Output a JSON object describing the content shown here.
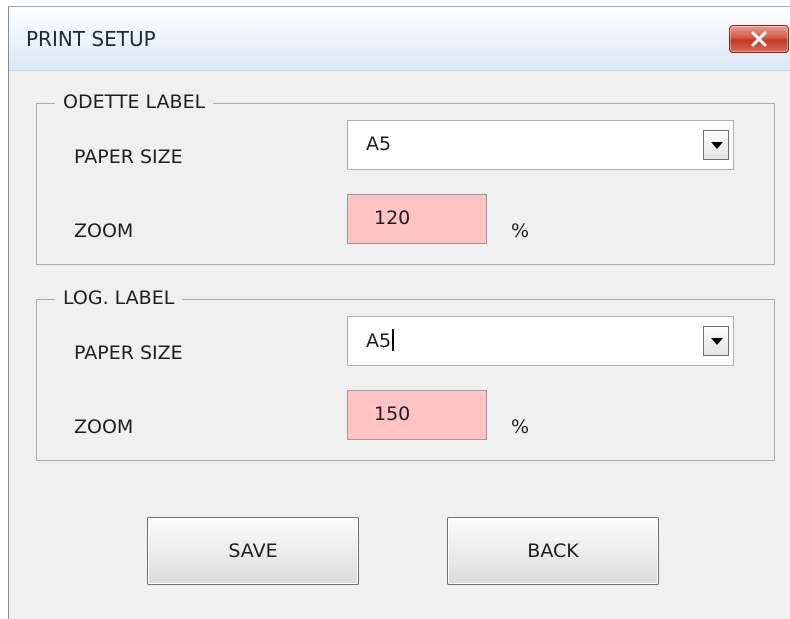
{
  "window": {
    "title": "PRINT SETUP",
    "close_icon": "close-icon"
  },
  "odette_label": {
    "legend": "ODETTE LABEL",
    "paper_size_label": "PAPER SIZE",
    "paper_size_value": "A5",
    "zoom_label": "ZOOM",
    "zoom_value": "120",
    "zoom_unit": "%"
  },
  "log_label": {
    "legend": "LOG. LABEL",
    "paper_size_label": "PAPER SIZE",
    "paper_size_value": "A5",
    "zoom_label": "ZOOM",
    "zoom_value": "150",
    "zoom_unit": "%"
  },
  "buttons": {
    "save_label": "SAVE",
    "back_label": "BACK"
  },
  "colors": {
    "zoom_field_background": "#ffc3c3",
    "close_button": "#c8452f",
    "dialog_background": "#f0f0f0"
  }
}
